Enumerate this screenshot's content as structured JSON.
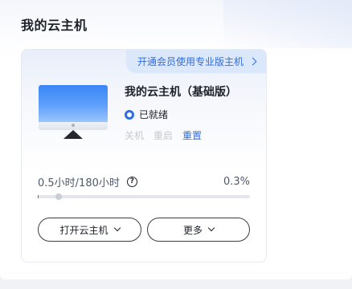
{
  "page": {
    "title": "我的云主机"
  },
  "card": {
    "promo_label": "开通会员使用专业版主机",
    "host_name": "我的云主机（基础版）",
    "status_text": "已就绪",
    "actions": {
      "shutdown": "关机",
      "restart": "重启",
      "reset": "重置"
    },
    "usage": {
      "text": "0.5小时/180小时",
      "help_glyph": "?",
      "percent_text": "0.3%",
      "progress_fraction": 0.003
    },
    "buttons": {
      "open": "打开云主机",
      "more": "更多"
    }
  },
  "colors": {
    "accent": "#2f6de0",
    "disabled": "#c5c9d0"
  }
}
